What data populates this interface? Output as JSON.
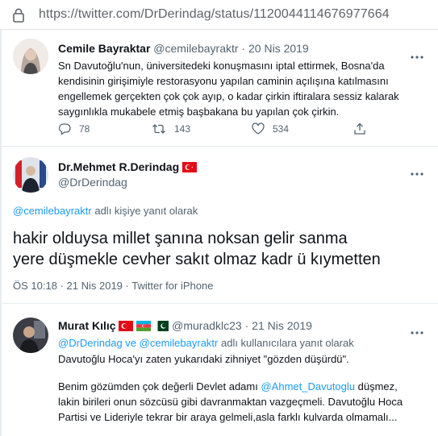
{
  "browser": {
    "url": "https://twitter.com/DrDerindag/status/1120044114676977664"
  },
  "tweet_parent": {
    "author_name": "Cemile Bayraktar",
    "handle": "@cemilebayraktr",
    "separator": "·",
    "date": "20 Nis 2019",
    "text": "Sn Davutoğlu'nun, üniversitedeki konuşmasını iptal ettirmek, Bosna'da kendisinin girişimiyle restorasyonu yapılan caminin açılışına katılmasını engellemek gerçekten çok çok ayıp, o kadar çirkin iftiralara sessiz kalarak saygınlıkla mukabele etmiş başbakana bu yapılan çok çirkin.",
    "replies": "78",
    "retweets": "143",
    "likes": "534"
  },
  "tweet_main": {
    "author_name": "Dr.Mehmet R.Derindag",
    "handle": "@DrDerindag",
    "reply_mention": "@cemilebayraktr",
    "reply_suffix": " adlı kişiye yanıt olarak",
    "text_line1": "hakir olduysa millet şanına noksan gelir sanma",
    "text_line2": "yere düşmekle cevher sakıt olmaz kadr ü kıymetten",
    "time": "ÖS 10:18",
    "separator": "·",
    "date": "21 Nis 2019",
    "source": "Twitter for iPhone"
  },
  "tweet_reply": {
    "author_name": "Murat Kılıç",
    "handle": "@muradklc23",
    "separator": "·",
    "date": "21 Nis 2019",
    "mention1": "@DrDerindag",
    "and_word": " ve ",
    "mention2": "@cemilebayraktr",
    "reply_suffix": " adlı kullanıcılara yanıt olarak",
    "para1": "Davutoğlu Hoca'yı zaten yukarıdaki zihniyet \"gözden düşürdü\".",
    "para2_before": "Benim gözümden çok değerli Devlet adamı ",
    "para2_mention": "@Ahmet_Davutoglu",
    "para2_after": " düşmez,",
    "para2_line2": "lakin birileri onun sözcüsü gibi davranmaktan vazgeçmeli. Davutoğlu Hoca",
    "para2_line3": "Partisi ve Lideriyle tekrar bir araya gelmeli,asla farklı kulvarda olmamalı..."
  },
  "colors": {
    "link": "#1d9bf0",
    "muted": "#536471",
    "text": "#0f1419"
  }
}
